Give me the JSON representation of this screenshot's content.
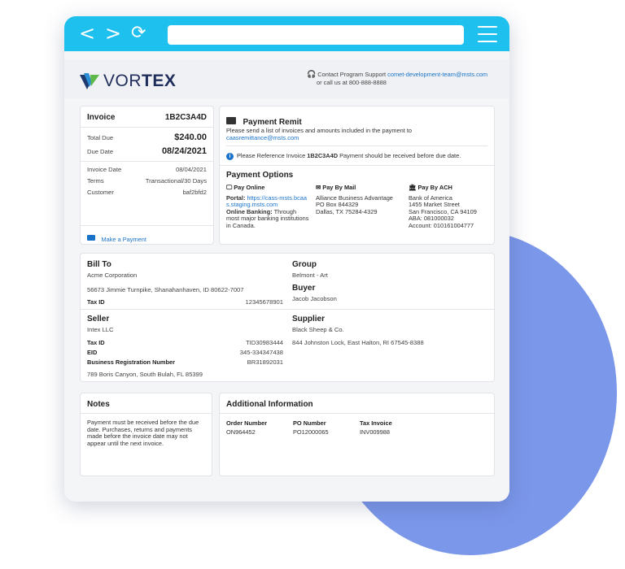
{
  "logo": {
    "text_light": "VOR",
    "text_bold": "TEX"
  },
  "support": {
    "line1_prefix": "Contact Program Support ",
    "email": "comet-development-team@msts.com",
    "line2": "or call us at 800-888-8888"
  },
  "invoice": {
    "label": "Invoice",
    "number": "1B2C3A4D",
    "total_due_label": "Total Due",
    "total_due": "$240.00",
    "due_date_label": "Due Date",
    "due_date": "08/24/2021",
    "invoice_date_label": "Invoice Date",
    "invoice_date": "08/04/2021",
    "terms_label": "Terms",
    "terms": "Transactional/30 Days",
    "customer_label": "Customer",
    "customer": "baf2bfd2",
    "make_payment": "Make a Payment"
  },
  "remit": {
    "title": "Payment Remit",
    "text": "Please send a list of invoices and amounts included in the payment to",
    "email": "caasremittance@msts.com",
    "ref_prefix": "Please Reference Invoice ",
    "ref_number": "1B2C3A4D",
    "ref_suffix": " Payment should be received before due date."
  },
  "options": {
    "title": "Payment Options",
    "online": {
      "title": "Pay Online",
      "portal_label": "Portal:",
      "portal_url": "https://cass-msts.bcaas.staging.msts.com",
      "banking_label": "Online Banking:",
      "banking_text": "Through most major banking institutions in Canada."
    },
    "mail": {
      "title": "Pay By Mail",
      "line1": "Alliance Business Advantage",
      "line2": "PO Box 844329",
      "line3": "Dallas, TX 75284-4329"
    },
    "ach": {
      "title": "Pay By ACH",
      "line1": "Bank of America",
      "line2": "1455 Market Street",
      "line3": "San Francisco, CA 94109",
      "line4": "ABA: 081000032",
      "line5": "Account: 010161004777"
    }
  },
  "billto": {
    "title": "Bill To",
    "name": "Acme Corporation",
    "address": "56673 Jimmie Turnpike, Shanahanhaven, ID 80622-7007",
    "tax_label": "Tax ID",
    "tax_id": "12345678901"
  },
  "group": {
    "title": "Group",
    "value": "Belmont - Art"
  },
  "buyer": {
    "title": "Buyer",
    "value": "Jacob Jacobson"
  },
  "seller": {
    "title": "Seller",
    "name": "Intex LLC",
    "tax_label": "Tax ID",
    "tax_id": "TID30983444",
    "eid_label": "EID",
    "eid": "345-334347438",
    "brn_label": "Business Registration Number",
    "brn": "BR31892031",
    "address": "789 Boris Canyon, South Bulah, FL 85399"
  },
  "supplier": {
    "title": "Supplier",
    "name": "Black Sheep & Co.",
    "address": "844 Johnston Lock, East Halton, RI 67545-8388"
  },
  "notes": {
    "title": "Notes",
    "text": "Payment must be received before the due date. Purchases, returns and payments made before the invoice date may not appear until the next invoice."
  },
  "additional": {
    "title": "Additional Information",
    "order_label": "Order Number",
    "order": "ON964452",
    "po_label": "PO Number",
    "po": "PO12000065",
    "tax_label": "Tax Invoice",
    "tax": "INV009988"
  }
}
